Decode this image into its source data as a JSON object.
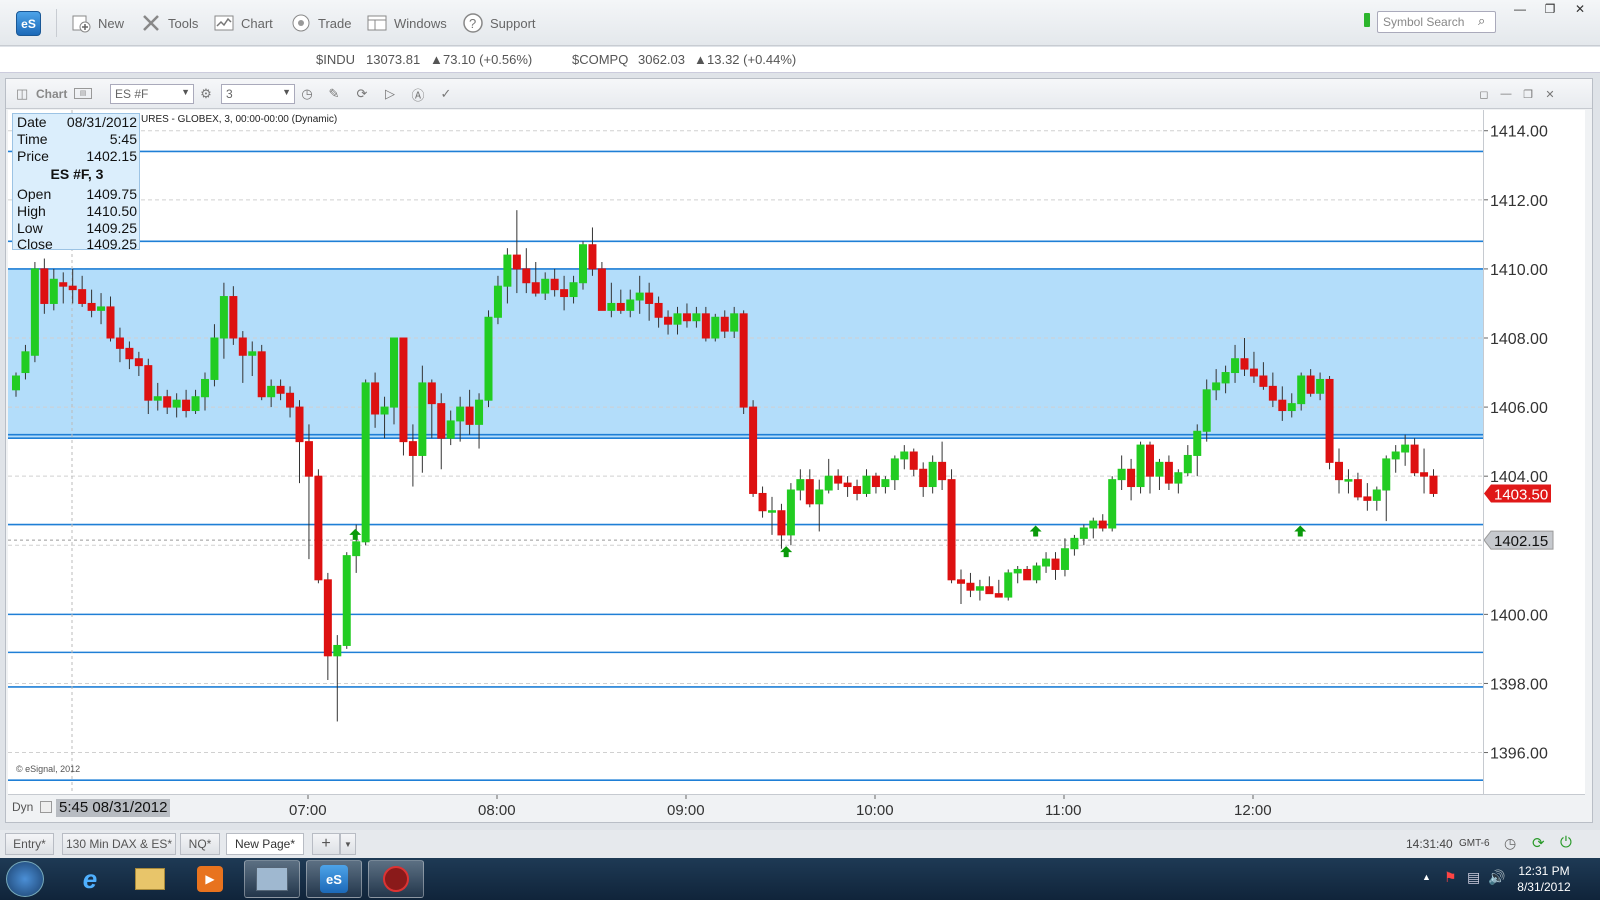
{
  "toolbar": {
    "logo": "eS",
    "new_label": "New",
    "tools_label": "Tools",
    "chart_label": "Chart",
    "trade_label": "Trade",
    "windows_label": "Windows",
    "support_label": "Support",
    "search_placeholder": "Symbol Search"
  },
  "ticker": {
    "sym1": "$INDU",
    "val1": "13073.81",
    "chg1": "73.10 (+0.56%)",
    "sym2": "$COMPQ",
    "val2": "3062.03",
    "chg2": "13.32 (+0.44%)"
  },
  "chart_window": {
    "title": "Chart",
    "symbol": "ES #F",
    "interval": "3",
    "subtitle": "URES - GLOBEX, 3, 00:00-00:00 (Dynamic)",
    "copyright": "© eSignal, 2012",
    "dyn_label": "Dyn",
    "cursor_time": "5:45 08/31/2012"
  },
  "info_panel": {
    "date_label": "Date",
    "date": "08/31/2012",
    "time_label": "Time",
    "time": "5:45",
    "price_label": "Price",
    "price": "1402.15",
    "series": "ES #F, 3",
    "open_label": "Open",
    "open": "1409.75",
    "high_label": "High",
    "high": "1410.50",
    "low_label": "Low",
    "low": "1409.25",
    "close_label": "Close",
    "close": "1409.25"
  },
  "price_axis": {
    "ticks": [
      "1414.00",
      "1412.00",
      "1410.00",
      "1408.00",
      "1406.00",
      "1404.00",
      "1400.00",
      "1398.00",
      "1396.00"
    ],
    "last_price": "1403.50",
    "crosshair_price": "1402.15"
  },
  "time_axis": {
    "ticks": [
      "07:00",
      "08:00",
      "09:00",
      "10:00",
      "11:00",
      "12:00"
    ]
  },
  "colors": {
    "up": "#22cc22",
    "down": "#dd1111",
    "zone": "#b3ddfa",
    "line": "#1f7fd6"
  },
  "tabs": [
    "Entry*",
    "130 Min DAX & ES*",
    "NQ*",
    "New Page*"
  ],
  "status": {
    "time": "14:31:40",
    "tz": "GMT-6"
  },
  "taskbar": {
    "time": "12:31 PM",
    "date": "8/31/2012"
  },
  "chart_data": {
    "type": "candlestick",
    "symbol": "ES #F",
    "ylim": [
      1394.8,
      1414.6
    ],
    "zone": [
      1405.1,
      1410.0
    ],
    "hlines": [
      1413.4,
      1410.8,
      1410.0,
      1405.2,
      1405.1,
      1402.6,
      1400.0,
      1398.9,
      1397.9,
      1395.2
    ],
    "crosshair": 1402.15,
    "candles": [
      [
        1406.5,
        1407.0,
        1406.3,
        1406.9
      ],
      [
        1407.0,
        1407.8,
        1406.8,
        1407.6
      ],
      [
        1407.5,
        1410.2,
        1407.3,
        1410.0
      ],
      [
        1410.0,
        1410.3,
        1408.7,
        1409.0
      ],
      [
        1409.0,
        1410.0,
        1408.8,
        1409.7
      ],
      [
        1409.6,
        1409.9,
        1409.0,
        1409.5
      ],
      [
        1409.5,
        1410.0,
        1409.0,
        1409.4
      ],
      [
        1409.4,
        1409.8,
        1408.9,
        1409.0
      ],
      [
        1409.0,
        1409.4,
        1408.6,
        1408.8
      ],
      [
        1408.8,
        1409.3,
        1408.4,
        1408.9
      ],
      [
        1408.9,
        1409.2,
        1407.9,
        1408.0
      ],
      [
        1408.0,
        1408.3,
        1407.3,
        1407.7
      ],
      [
        1407.7,
        1407.9,
        1407.1,
        1407.4
      ],
      [
        1407.4,
        1407.6,
        1406.9,
        1407.2
      ],
      [
        1407.2,
        1407.4,
        1405.8,
        1406.2
      ],
      [
        1406.2,
        1406.7,
        1405.9,
        1406.3
      ],
      [
        1406.3,
        1406.5,
        1405.8,
        1406.0
      ],
      [
        1406.0,
        1406.4,
        1405.7,
        1406.2
      ],
      [
        1406.2,
        1406.5,
        1405.7,
        1405.9
      ],
      [
        1405.9,
        1406.5,
        1405.8,
        1406.3
      ],
      [
        1406.3,
        1407.0,
        1405.9,
        1406.8
      ],
      [
        1406.8,
        1408.4,
        1406.6,
        1408.0
      ],
      [
        1408.0,
        1409.6,
        1407.4,
        1409.2
      ],
      [
        1409.2,
        1409.5,
        1407.8,
        1408.0
      ],
      [
        1408.0,
        1408.2,
        1406.7,
        1407.5
      ],
      [
        1407.5,
        1407.9,
        1406.9,
        1407.6
      ],
      [
        1407.6,
        1407.8,
        1406.2,
        1406.3
      ],
      [
        1406.3,
        1406.8,
        1406.0,
        1406.6
      ],
      [
        1406.6,
        1406.8,
        1406.2,
        1406.4
      ],
      [
        1406.4,
        1406.6,
        1405.7,
        1406.0
      ],
      [
        1406.0,
        1406.2,
        1403.8,
        1405.0
      ],
      [
        1405.0,
        1405.5,
        1401.6,
        1404.0
      ],
      [
        1404.0,
        1404.2,
        1400.9,
        1401.0
      ],
      [
        1401.0,
        1401.2,
        1398.1,
        1398.8
      ],
      [
        1398.8,
        1399.4,
        1396.9,
        1399.1
      ],
      [
        1399.1,
        1401.8,
        1399.0,
        1401.7
      ],
      [
        1401.7,
        1402.6,
        1401.2,
        1402.1
      ],
      [
        1402.1,
        1406.8,
        1402.0,
        1406.7
      ],
      [
        1406.7,
        1407.0,
        1405.4,
        1405.8
      ],
      [
        1405.8,
        1406.3,
        1405.1,
        1406.0
      ],
      [
        1406.0,
        1408.0,
        1405.5,
        1408.0
      ],
      [
        1408.0,
        1408.0,
        1404.6,
        1405.0
      ],
      [
        1405.0,
        1405.5,
        1403.7,
        1404.6
      ],
      [
        1404.6,
        1407.2,
        1404.1,
        1406.7
      ],
      [
        1406.7,
        1406.8,
        1405.1,
        1406.1
      ],
      [
        1406.1,
        1406.4,
        1404.2,
        1405.1
      ],
      [
        1405.1,
        1405.9,
        1404.9,
        1405.6
      ],
      [
        1405.6,
        1406.3,
        1405.0,
        1406.0
      ],
      [
        1406.0,
        1406.5,
        1405.2,
        1405.5
      ],
      [
        1405.5,
        1406.4,
        1404.8,
        1406.2
      ],
      [
        1406.2,
        1408.8,
        1406.0,
        1408.6
      ],
      [
        1408.6,
        1409.8,
        1408.4,
        1409.5
      ],
      [
        1409.5,
        1410.6,
        1409.0,
        1410.4
      ],
      [
        1410.4,
        1411.7,
        1409.3,
        1410.0
      ],
      [
        1410.0,
        1410.6,
        1409.3,
        1409.6
      ],
      [
        1409.6,
        1410.2,
        1409.2,
        1409.3
      ],
      [
        1409.3,
        1409.9,
        1409.1,
        1409.7
      ],
      [
        1409.7,
        1410.0,
        1409.2,
        1409.4
      ],
      [
        1409.4,
        1409.8,
        1408.8,
        1409.2
      ],
      [
        1409.2,
        1409.8,
        1409.0,
        1409.6
      ],
      [
        1409.6,
        1410.8,
        1409.4,
        1410.7
      ],
      [
        1410.7,
        1411.2,
        1409.8,
        1410.0
      ],
      [
        1410.0,
        1410.2,
        1408.8,
        1408.8
      ],
      [
        1408.8,
        1409.6,
        1408.6,
        1409.0
      ],
      [
        1409.0,
        1409.4,
        1408.7,
        1408.8
      ],
      [
        1408.8,
        1409.4,
        1408.6,
        1409.1
      ],
      [
        1409.1,
        1409.8,
        1408.7,
        1409.3
      ],
      [
        1409.3,
        1409.6,
        1408.5,
        1409.0
      ],
      [
        1409.0,
        1409.2,
        1408.3,
        1408.6
      ],
      [
        1408.6,
        1408.8,
        1408.1,
        1408.4
      ],
      [
        1408.4,
        1408.9,
        1408.1,
        1408.7
      ],
      [
        1408.7,
        1409.0,
        1408.3,
        1408.5
      ],
      [
        1408.5,
        1408.9,
        1408.3,
        1408.7
      ],
      [
        1408.7,
        1408.9,
        1407.9,
        1408.0
      ],
      [
        1408.0,
        1408.7,
        1407.9,
        1408.6
      ],
      [
        1408.6,
        1408.8,
        1408.0,
        1408.2
      ],
      [
        1408.2,
        1408.9,
        1408.0,
        1408.7
      ],
      [
        1408.7,
        1408.8,
        1405.8,
        1406.0
      ],
      [
        1406.0,
        1406.2,
        1403.4,
        1403.5
      ],
      [
        1403.5,
        1403.7,
        1402.8,
        1403.0
      ],
      [
        1403.0,
        1403.4,
        1402.3,
        1403.0
      ],
      [
        1403.0,
        1403.2,
        1401.9,
        1402.3
      ],
      [
        1402.3,
        1403.8,
        1402.0,
        1403.6
      ],
      [
        1403.6,
        1404.2,
        1403.3,
        1403.9
      ],
      [
        1403.9,
        1404.2,
        1403.1,
        1403.2
      ],
      [
        1403.2,
        1403.9,
        1402.4,
        1403.6
      ],
      [
        1403.6,
        1404.5,
        1403.5,
        1404.0
      ],
      [
        1404.0,
        1404.2,
        1403.6,
        1403.8
      ],
      [
        1403.8,
        1404.0,
        1403.4,
        1403.7
      ],
      [
        1403.7,
        1403.9,
        1403.3,
        1403.5
      ],
      [
        1403.5,
        1404.2,
        1403.4,
        1404.0
      ],
      [
        1404.0,
        1404.1,
        1403.5,
        1403.7
      ],
      [
        1403.7,
        1404.0,
        1403.5,
        1403.9
      ],
      [
        1403.9,
        1404.6,
        1403.6,
        1404.5
      ],
      [
        1404.5,
        1404.9,
        1404.2,
        1404.7
      ],
      [
        1404.7,
        1404.8,
        1404.0,
        1404.2
      ],
      [
        1404.2,
        1404.4,
        1403.4,
        1403.7
      ],
      [
        1403.7,
        1404.6,
        1403.5,
        1404.4
      ],
      [
        1404.4,
        1405.0,
        1403.6,
        1403.9
      ],
      [
        1403.9,
        1404.2,
        1400.9,
        1401.0
      ],
      [
        1401.0,
        1401.3,
        1400.3,
        1400.9
      ],
      [
        1400.9,
        1401.2,
        1400.5,
        1400.7
      ],
      [
        1400.7,
        1401.0,
        1400.4,
        1400.8
      ],
      [
        1400.8,
        1401.1,
        1400.6,
        1400.6
      ],
      [
        1400.6,
        1401.0,
        1400.5,
        1400.5
      ],
      [
        1400.5,
        1401.3,
        1400.4,
        1401.2
      ],
      [
        1401.2,
        1401.4,
        1400.9,
        1401.3
      ],
      [
        1401.3,
        1401.4,
        1401.0,
        1401.0
      ],
      [
        1401.0,
        1401.5,
        1400.9,
        1401.4
      ],
      [
        1401.4,
        1401.8,
        1401.2,
        1401.6
      ],
      [
        1401.6,
        1401.8,
        1401.0,
        1401.3
      ],
      [
        1401.3,
        1402.2,
        1401.1,
        1401.9
      ],
      [
        1401.9,
        1402.3,
        1401.7,
        1402.2
      ],
      [
        1402.2,
        1402.6,
        1402.0,
        1402.5
      ],
      [
        1402.5,
        1402.8,
        1402.2,
        1402.7
      ],
      [
        1402.7,
        1402.9,
        1402.4,
        1402.5
      ],
      [
        1402.5,
        1404.0,
        1402.4,
        1403.9
      ],
      [
        1403.9,
        1404.6,
        1403.6,
        1404.2
      ],
      [
        1404.2,
        1404.5,
        1403.3,
        1403.7
      ],
      [
        1403.7,
        1405.0,
        1403.5,
        1404.9
      ],
      [
        1404.9,
        1405.0,
        1403.5,
        1404.0
      ],
      [
        1404.0,
        1404.5,
        1403.6,
        1404.4
      ],
      [
        1404.4,
        1404.6,
        1403.6,
        1403.8
      ],
      [
        1403.8,
        1404.2,
        1403.5,
        1404.1
      ],
      [
        1404.1,
        1404.9,
        1404.0,
        1404.6
      ],
      [
        1404.6,
        1405.5,
        1404.0,
        1405.3
      ],
      [
        1405.3,
        1406.8,
        1405.0,
        1406.5
      ],
      [
        1406.5,
        1407.1,
        1406.2,
        1406.7
      ],
      [
        1406.7,
        1407.2,
        1406.4,
        1407.0
      ],
      [
        1407.0,
        1407.8,
        1406.7,
        1407.4
      ],
      [
        1407.4,
        1408.0,
        1406.9,
        1407.1
      ],
      [
        1407.1,
        1407.6,
        1406.7,
        1406.9
      ],
      [
        1406.9,
        1407.3,
        1406.5,
        1406.6
      ],
      [
        1406.6,
        1407.0,
        1406.0,
        1406.2
      ],
      [
        1406.2,
        1406.6,
        1405.6,
        1405.9
      ],
      [
        1405.9,
        1406.4,
        1405.7,
        1406.1
      ],
      [
        1406.1,
        1407.0,
        1405.9,
        1406.9
      ],
      [
        1406.9,
        1407.1,
        1406.3,
        1406.4
      ],
      [
        1406.4,
        1407.0,
        1406.2,
        1406.8
      ],
      [
        1406.8,
        1406.9,
        1404.2,
        1404.4
      ],
      [
        1404.4,
        1404.8,
        1403.5,
        1403.9
      ],
      [
        1403.9,
        1404.2,
        1403.5,
        1403.9
      ],
      [
        1403.9,
        1404.1,
        1403.3,
        1403.4
      ],
      [
        1403.4,
        1403.8,
        1403.0,
        1403.3
      ],
      [
        1403.3,
        1403.7,
        1403.0,
        1403.6
      ],
      [
        1403.6,
        1404.6,
        1402.7,
        1404.5
      ],
      [
        1404.5,
        1404.9,
        1404.1,
        1404.7
      ],
      [
        1404.7,
        1405.2,
        1404.3,
        1404.9
      ],
      [
        1404.9,
        1405.1,
        1404.0,
        1404.1
      ],
      [
        1404.1,
        1404.8,
        1403.5,
        1404.0
      ],
      [
        1404.0,
        1404.2,
        1403.4,
        1403.5
      ]
    ],
    "signals": [
      [
        7.25,
        1402.3
      ],
      [
        9.53,
        1401.8
      ],
      [
        10.85,
        1402.4
      ],
      [
        12.25,
        1402.4
      ]
    ]
  }
}
